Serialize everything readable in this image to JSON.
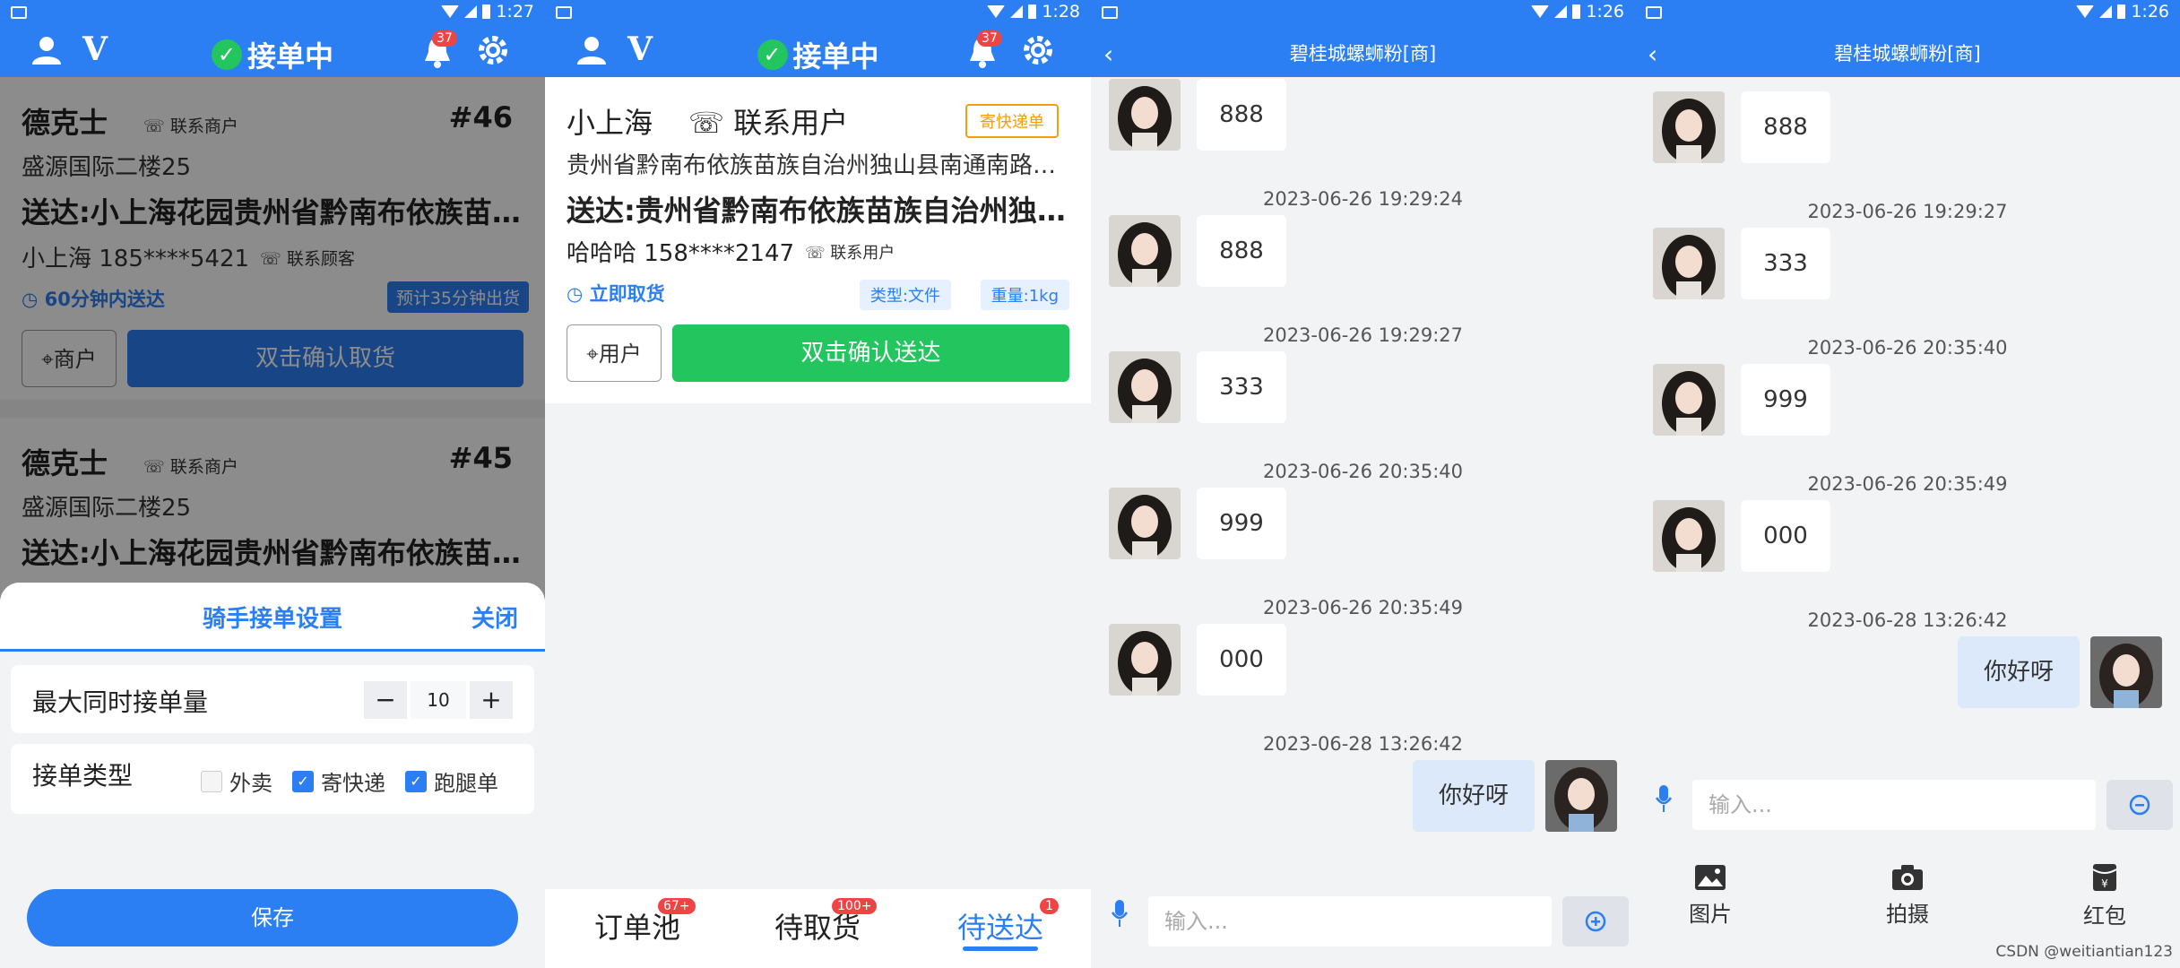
{
  "status": {
    "times": [
      "1:27",
      "1:28",
      "1:26",
      "1:26"
    ]
  },
  "appbar": {
    "title": "接单中",
    "bell_badge": "37"
  },
  "panel1": {
    "orders": [
      {
        "merchant": "德克士",
        "contact_label": "联系商户",
        "number": "#46",
        "address": "盛源国际二楼25",
        "dest": "送达:小上海花园贵州省黔南布依族苗族自治州独山县南通南路",
        "customer": "小上海 185****5421",
        "customer_contact": "联系顾客",
        "time_text": "60分钟内送达",
        "eta": "预计35分钟出货",
        "btn_merchant": "商户",
        "btn_confirm": "双击确认取货"
      },
      {
        "merchant": "德克士",
        "contact_label": "联系商户",
        "number": "#45",
        "address": "盛源国际二楼25",
        "dest": "送达:小上海花园贵州省黔南布依族苗族自治州独山县南通南路"
      }
    ],
    "sheet": {
      "title": "骑手接单设置",
      "close": "关闭",
      "max_label": "最大同时接单量",
      "minus": "−",
      "max_value": "10",
      "plus": "+",
      "type_label": "接单类型",
      "types": [
        {
          "label": "外卖",
          "checked": false
        },
        {
          "label": "寄快递",
          "checked": true
        },
        {
          "label": "跑腿单",
          "checked": true
        }
      ],
      "check_mark": "✓",
      "save": "保存"
    }
  },
  "panel2": {
    "name": "小上海",
    "contact": "联系用户",
    "tag": "寄快递单",
    "address": "贵州省黔南布依族苗族自治州独山县南通南路商务中心",
    "dest": "送达:贵州省黔南布依族苗族自治州独山县南通南路",
    "customer": "哈哈哈 158****2147",
    "customer_contact": "联系用户",
    "time_text": "立即取货",
    "chip_type": "类型:文件",
    "chip_weight": "重量:1kg",
    "btn_user": "用户",
    "btn_confirm": "双击确认送达",
    "tabs": [
      {
        "label": "订单池",
        "badge": "67+"
      },
      {
        "label": "待取货",
        "badge": "100+"
      },
      {
        "label": "待送达",
        "badge": "1"
      }
    ]
  },
  "chat": {
    "title": "碧桂城螺蛳粉[商]",
    "panel3_msgs": [
      {
        "text": "888"
      },
      {
        "time": "2023-06-26 19:29:24"
      },
      {
        "text": "888"
      },
      {
        "time": "2023-06-26 19:29:27"
      },
      {
        "text": "333"
      },
      {
        "time": "2023-06-26 20:35:40"
      },
      {
        "text": "999"
      },
      {
        "time": "2023-06-26 20:35:49"
      },
      {
        "text": "000"
      },
      {
        "time": "2023-06-28 13:26:42"
      },
      {
        "text": "你好呀",
        "mine": true
      }
    ],
    "panel4_msgs": [
      {
        "text": "888"
      },
      {
        "time": "2023-06-26 19:29:27"
      },
      {
        "text": "333"
      },
      {
        "time": "2023-06-26 20:35:40"
      },
      {
        "text": "999"
      },
      {
        "time": "2023-06-26 20:35:49"
      },
      {
        "text": "000"
      },
      {
        "time": "2023-06-28 13:26:42"
      },
      {
        "text": "你好呀",
        "mine": true
      }
    ],
    "input_placeholder": "输入...",
    "tools": [
      {
        "label": "图片",
        "icon": "image-icon"
      },
      {
        "label": "拍摄",
        "icon": "camera-icon"
      },
      {
        "label": "红包",
        "icon": "red-packet-icon"
      }
    ]
  },
  "watermark": "CSDN @weitiantian123",
  "colors": {
    "primary": "#2b7ff2",
    "green": "#22c55e",
    "orange": "#f59e0b",
    "badge": "#ef4444"
  }
}
